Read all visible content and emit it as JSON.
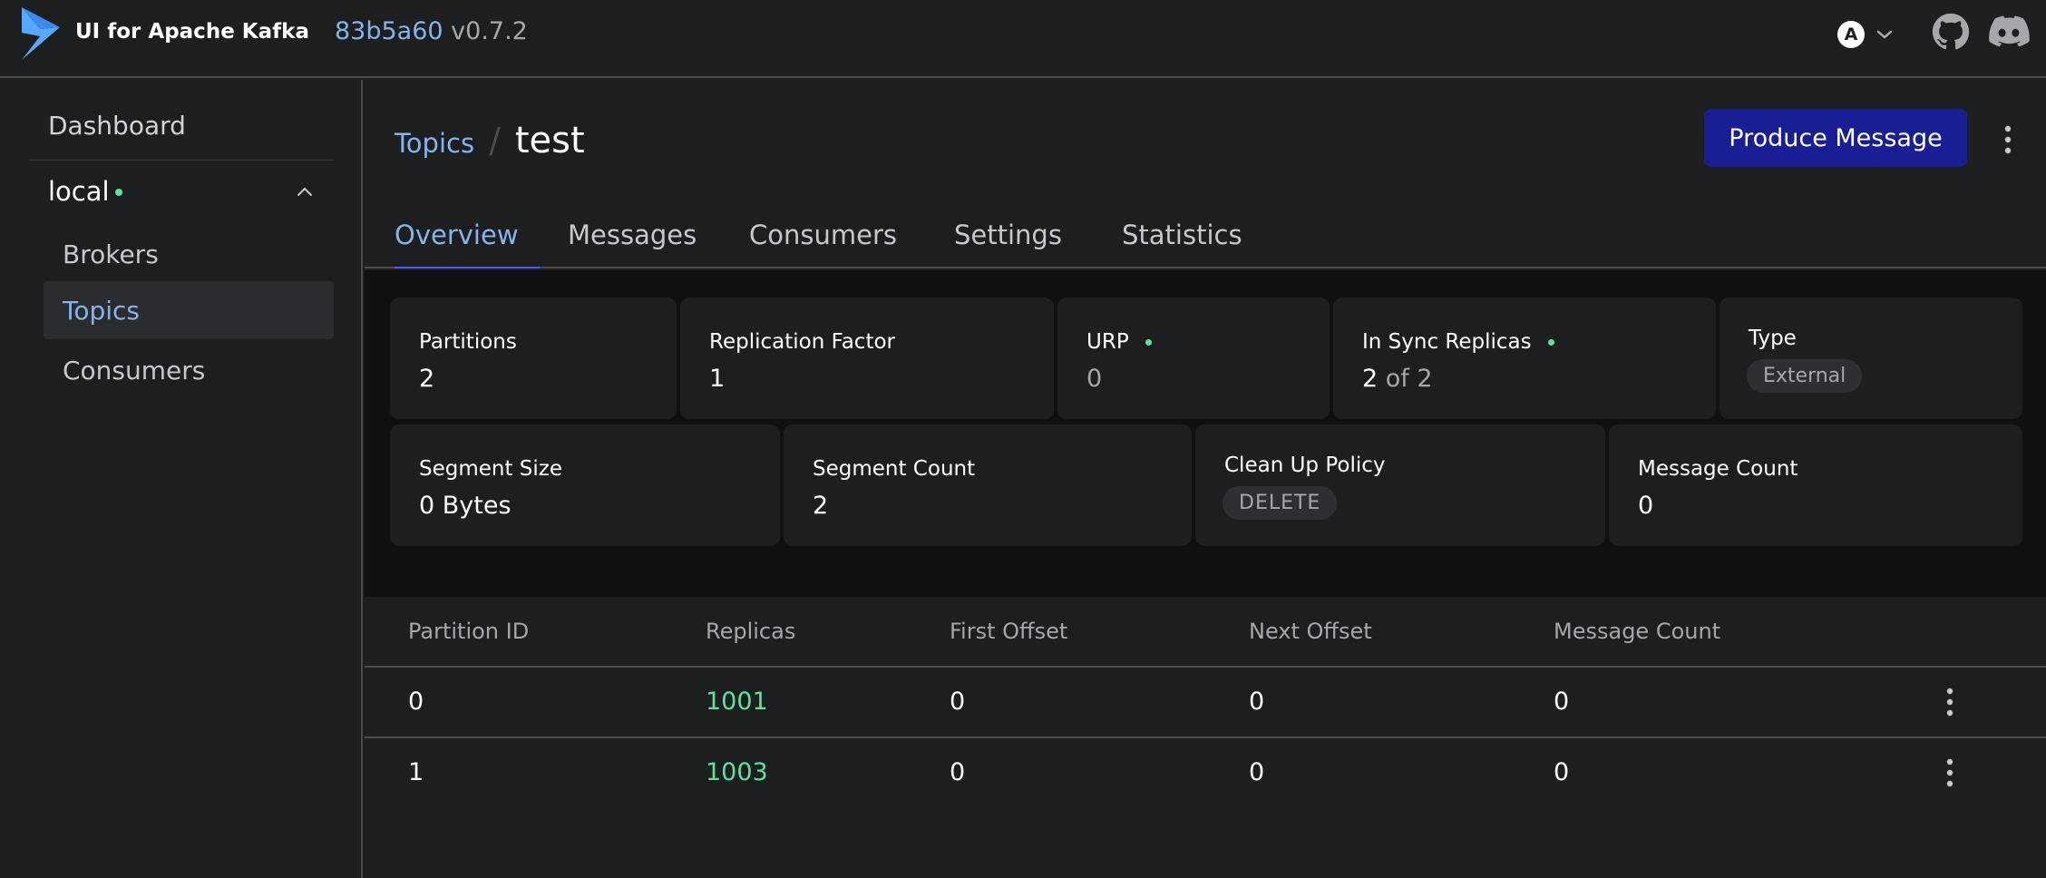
{
  "app": {
    "title": "UI for Apache Kafka",
    "version_hash": "83b5a60",
    "version": "v0.7.2",
    "avatar_letter": "A"
  },
  "sidebar": {
    "dashboard": "Dashboard",
    "cluster": {
      "name": "local",
      "status_color": "#5be49b"
    },
    "items": [
      {
        "label": "Brokers",
        "active": false
      },
      {
        "label": "Topics",
        "active": true
      },
      {
        "label": "Consumers",
        "active": false
      }
    ]
  },
  "breadcrumb": {
    "parent": "Topics",
    "separator": "/",
    "current": "test"
  },
  "header": {
    "produce_label": "Produce Message"
  },
  "tabs": [
    {
      "label": "Overview",
      "active": true
    },
    {
      "label": "Messages",
      "active": false
    },
    {
      "label": "Consumers",
      "active": false
    },
    {
      "label": "Settings",
      "active": false
    },
    {
      "label": "Statistics",
      "active": false
    }
  ],
  "stats": {
    "partitions": {
      "label": "Partitions",
      "value": "2"
    },
    "replication_factor": {
      "label": "Replication Factor",
      "value": "1"
    },
    "urp": {
      "label": "URP",
      "value": "0"
    },
    "in_sync": {
      "label": "In Sync Replicas",
      "value_num": "2",
      "value_of": "of 2"
    },
    "type": {
      "label": "Type",
      "value": "External"
    },
    "segment_size": {
      "label": "Segment Size",
      "value": "0 Bytes"
    },
    "segment_count": {
      "label": "Segment Count",
      "value": "2"
    },
    "cleanup_policy": {
      "label": "Clean Up Policy",
      "value": "DELETE"
    },
    "message_count": {
      "label": "Message Count",
      "value": "0"
    }
  },
  "table": {
    "headers": [
      "Partition ID",
      "Replicas",
      "First Offset",
      "Next Offset",
      "Message Count"
    ],
    "rows": [
      {
        "partition_id": "0",
        "replicas": "1001",
        "first_offset": "0",
        "next_offset": "0",
        "message_count": "0"
      },
      {
        "partition_id": "1",
        "replicas": "1003",
        "first_offset": "0",
        "next_offset": "0",
        "message_count": "0"
      }
    ]
  },
  "colors": {
    "accent": "#85b4eb",
    "primary_button": "#1a1e94",
    "success": "#5be49b",
    "background": "#1d1e20"
  }
}
